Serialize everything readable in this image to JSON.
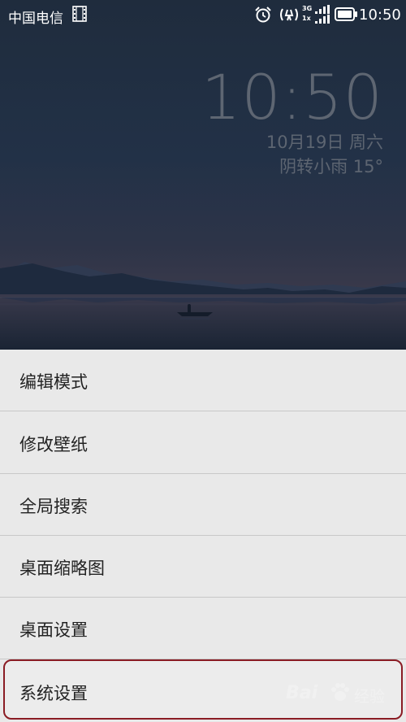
{
  "status_bar": {
    "carrier": "中国电信",
    "time": "10:50",
    "network_label_top": "3G",
    "network_label_bottom": "1x"
  },
  "clock_widget": {
    "time": "10:50",
    "date": "10月19日 周六",
    "weather": "阴转小雨  15°"
  },
  "menu": {
    "items": [
      {
        "label": "编辑模式"
      },
      {
        "label": "修改壁纸"
      },
      {
        "label": "全局搜索"
      },
      {
        "label": "桌面缩略图"
      },
      {
        "label": "桌面设置"
      },
      {
        "label": "系统设置",
        "selected": true
      }
    ]
  },
  "watermark": {
    "brand": "Bai",
    "suffix": "经验"
  },
  "colors": {
    "menu_background": "#e9e9e9",
    "highlight_border": "#8a1c24",
    "clock_text": "#5e6672"
  },
  "icons": [
    "film-icon",
    "alarm-icon",
    "signal-dual-icon",
    "net-signal-icon",
    "battery-icon",
    "paw-icon"
  ]
}
